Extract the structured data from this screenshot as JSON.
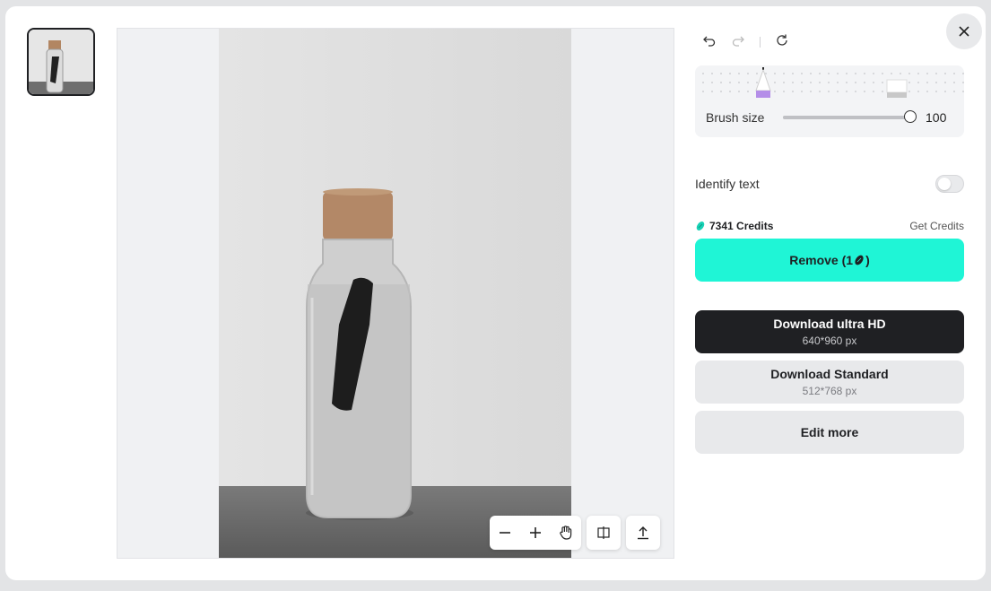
{
  "close": {
    "icon": "close-icon"
  },
  "history": {
    "undo_icon": "undo-icon",
    "redo_icon": "redo-icon",
    "reset_icon": "refresh-icon"
  },
  "brush": {
    "label": "Brush size",
    "value": "100",
    "level": 1.0
  },
  "identify_text": {
    "label": "Identify text",
    "enabled": false
  },
  "credits": {
    "amount": "7341 Credits",
    "get_link": "Get Credits"
  },
  "remove_button": {
    "label": "Remove (1",
    "suffix": ")"
  },
  "download_hd": {
    "title": "Download ultra HD",
    "size": "640*960 px"
  },
  "download_standard": {
    "title": "Download Standard",
    "size": "512*768 px"
  },
  "edit_more": {
    "label": "Edit more"
  },
  "toolbar": {
    "icons": [
      "zoom-out-icon",
      "zoom-in-icon",
      "hand-icon",
      "compare-icon",
      "upload-icon"
    ]
  },
  "colors": {
    "accent": "#1ff5d6",
    "dark": "#1f2023",
    "light": "#e8e9eb"
  }
}
